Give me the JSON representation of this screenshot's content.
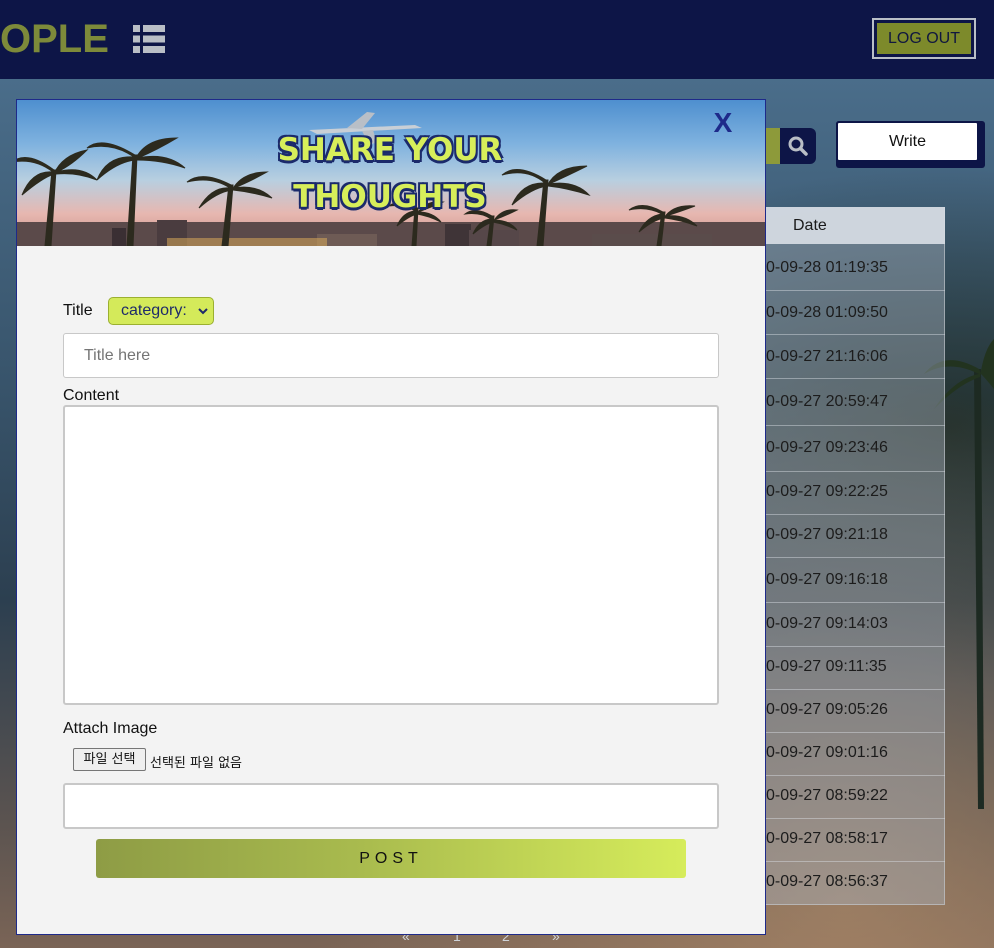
{
  "header": {
    "brand_partial": "OPLE",
    "menu_icon": "list-icon",
    "logout_label": "LOG OUT"
  },
  "toolbar": {
    "search_icon": "search-icon",
    "write_label": "Write"
  },
  "table": {
    "date_header": "Date",
    "dates": [
      "0-09-28 01:19:35",
      "0-09-28 01:09:50",
      "0-09-27 21:16:06",
      "0-09-27 20:59:47",
      "0-09-27 09:23:46",
      "0-09-27 09:22:25",
      "0-09-27 09:21:18",
      "0-09-27 09:16:18",
      "0-09-27 09:14:03",
      "0-09-27 09:11:35",
      "0-09-27 09:05:26",
      "0-09-27 09:01:16",
      "0-09-27 08:59:22",
      "0-09-27 08:58:17",
      "0-09-27 08:56:37"
    ]
  },
  "pagination": {
    "prev": "«",
    "pages": [
      "1",
      "2"
    ],
    "next": "»"
  },
  "modal": {
    "hero_title_line1": "SHARE YOUR",
    "hero_title_line2": "THOUGHTS",
    "close_label": "X",
    "title_label": "Title",
    "category_selected": "category:",
    "title_placeholder": "Title here",
    "content_label": "Content",
    "attach_label": "Attach Image",
    "file_button_label": "파일 선택",
    "file_status": "선택된 파일 없음",
    "post_label": "POST"
  },
  "colors": {
    "navy": "#0d1547",
    "olive": "#7d8a2b",
    "lime": "#d4ea5a",
    "modal_border": "#1e2a8a"
  }
}
